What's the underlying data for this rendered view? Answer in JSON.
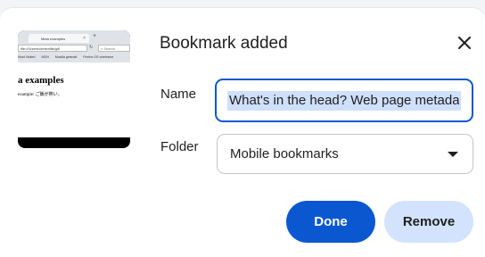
{
  "thumbnail": {
    "tab_title": "Meta examples",
    "url": "file:///Users/chrismills/git/",
    "search_placeholder": "Search",
    "bookmarks": [
      "Most Visited",
      "MDN",
      "Mozilla getsnail",
      "Firefox OS wireframe"
    ],
    "heading": "a examples",
    "line": "example: ご飯が熱い。"
  },
  "dialog": {
    "title": "Bookmark added",
    "name_label": "Name",
    "name_value": "What's in the head? Web page metadata",
    "folder_label": "Folder",
    "folder_value": "Mobile bookmarks",
    "done_label": "Done",
    "remove_label": "Remove"
  },
  "colors": {
    "accent": "#0b57d0",
    "selection": "#cfe0fc",
    "secondary_button": "#d3e3fd"
  }
}
